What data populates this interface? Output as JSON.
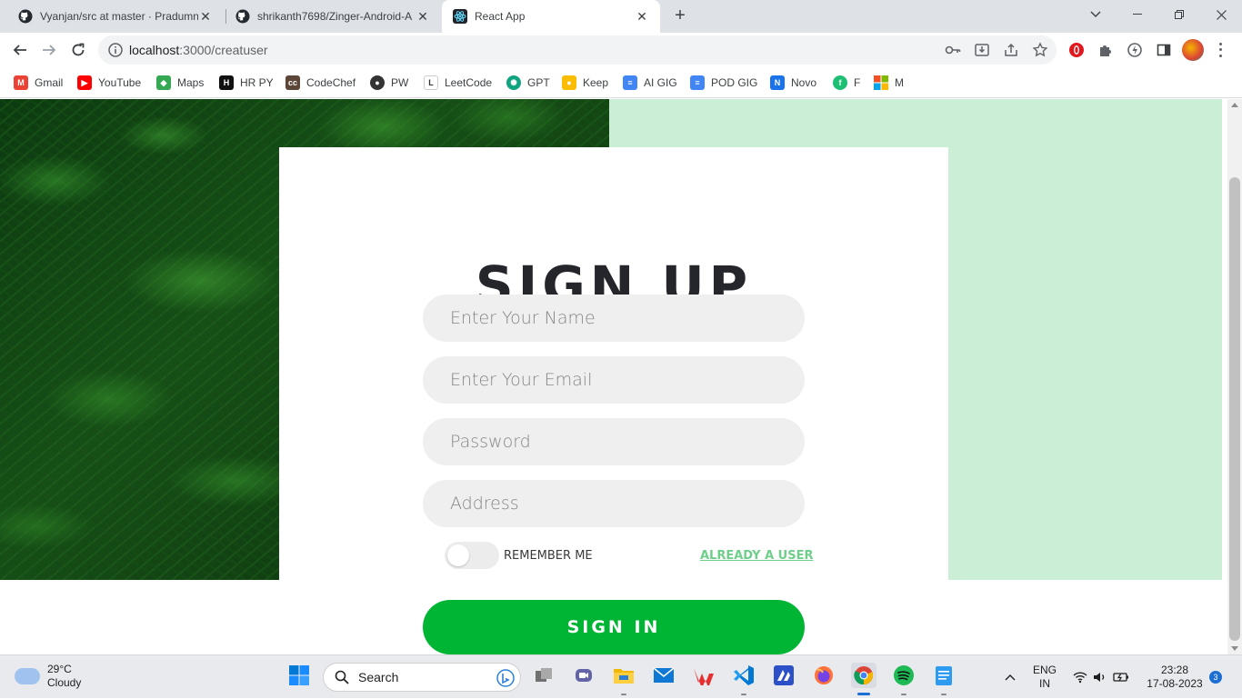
{
  "browser": {
    "tabs": [
      {
        "title": "Vyanjan/src at master · Pradumn",
        "icon": "github-icon"
      },
      {
        "title": "shrikanth7698/Zinger-Android-A",
        "icon": "github-icon"
      },
      {
        "title": "React App",
        "icon": "react-icon"
      }
    ],
    "new_tab": "+",
    "url_host": "localhost",
    "url_path": ":3000/creatuser"
  },
  "bookmarks": [
    {
      "label": "Gmail",
      "icon": "gmail-icon",
      "color": "#ea4335",
      "glyph": "M"
    },
    {
      "label": "YouTube",
      "icon": "youtube-icon",
      "color": "#ff0000",
      "glyph": "▶"
    },
    {
      "label": "Maps",
      "icon": "maps-icon",
      "color": "#34a853",
      "glyph": "◆"
    },
    {
      "label": "HR PY",
      "icon": "hackerrank-icon",
      "color": "#111111",
      "glyph": "H"
    },
    {
      "label": "CodeChef",
      "icon": "codechef-icon",
      "color": "#5b4638",
      "glyph": "cc"
    },
    {
      "label": "PW",
      "icon": "pw-icon",
      "color": "#333333",
      "glyph": "●"
    },
    {
      "label": "LeetCode",
      "icon": "leetcode-icon",
      "color": "#ffa116",
      "glyph": "L"
    },
    {
      "label": "GPT",
      "icon": "openai-icon",
      "color": "#10a37f",
      "glyph": "✺"
    },
    {
      "label": "Keep",
      "icon": "keep-icon",
      "color": "#fbbc04",
      "glyph": "●"
    },
    {
      "label": "AI GIG",
      "icon": "docs-icon",
      "color": "#4285f4",
      "glyph": "≡"
    },
    {
      "label": "POD GIG",
      "icon": "docs-icon",
      "color": "#4285f4",
      "glyph": "≡"
    },
    {
      "label": "Novo",
      "icon": "novo-icon",
      "color": "#1a73e8",
      "glyph": "N"
    },
    {
      "label": "F",
      "icon": "fiverr-icon",
      "color": "#1dbf73",
      "glyph": "f"
    },
    {
      "label": "M",
      "icon": "microsoft-icon",
      "color": "#f25022",
      "glyph": "■"
    }
  ],
  "form": {
    "title": "SIGN UP",
    "name_placeholder": "Enter Your Name",
    "email_placeholder": "Enter Your Email",
    "password_placeholder": "Password",
    "address_placeholder": "Address",
    "remember_label": "REMEMBER ME",
    "already_user_link": "ALREADY A USER",
    "submit_label": "SIGN IN"
  },
  "colors": {
    "accent_green": "#00b533",
    "mint_panel": "#cbefd6",
    "link_green": "#6fcf8a"
  },
  "taskbar": {
    "weather_temp": "29°C",
    "weather_desc": "Cloudy",
    "search_label": "Search",
    "lang_top": "ENG",
    "lang_bottom": "IN",
    "time": "23:28",
    "date": "17-08-2023",
    "notification_count": "3"
  }
}
